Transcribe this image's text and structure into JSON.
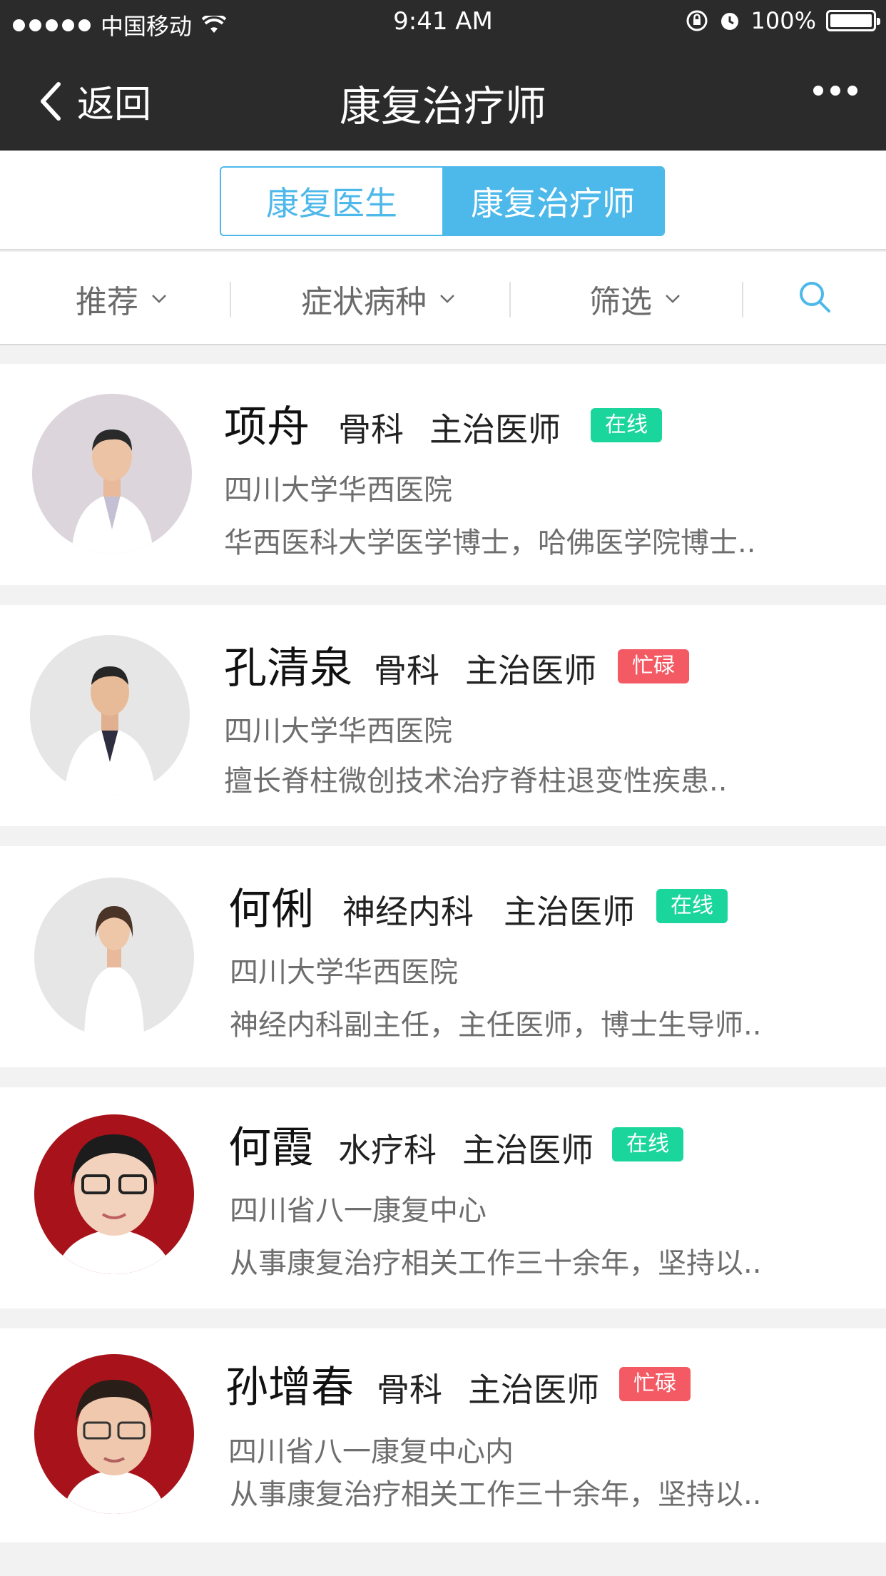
{
  "status_bar": {
    "carrier": "中国移动",
    "time": "9:41 AM",
    "battery": "100%",
    "battery_level": 1.0
  },
  "nav": {
    "back_label": "返回",
    "title": "康复治疗师"
  },
  "segments": [
    {
      "label": "康复医生",
      "active": false
    },
    {
      "label": "康复治疗师",
      "active": true
    }
  ],
  "filters": {
    "recommend": "推荐",
    "symptoms": "症状病种",
    "filter": "筛选"
  },
  "colors": {
    "accent": "#4db8ea",
    "online": "#1ad69c",
    "busy": "#f45a64",
    "nav_bg": "#2b2b2b"
  },
  "doctors": [
    {
      "name": "项舟",
      "dept": "骨科",
      "title": "主治医师",
      "status": "在线",
      "hospital": "四川大学华西医院",
      "desc": "华西医科大学医学博士，哈佛医学院博士.."
    },
    {
      "name": "孔清泉",
      "dept": "骨科",
      "title": "主治医师",
      "status": "忙碌",
      "hospital": "四川大学华西医院",
      "desc": "擅长脊柱微创技术治疗脊柱退变性疾患.."
    },
    {
      "name": "何俐",
      "dept": "神经内科",
      "title": "主治医师",
      "status": "在线",
      "hospital": "四川大学华西医院",
      "desc": "神经内科副主任，主任医师，博士生导师.."
    },
    {
      "name": "何霞",
      "dept": "水疗科",
      "title": "主治医师",
      "status": "在线",
      "hospital": "四川省八一康复中心",
      "desc": "从事康复治疗相关工作三十余年，坚持以.."
    },
    {
      "name": "孙增春",
      "dept": "骨科",
      "title": "主治医师",
      "status": "忙碌",
      "hospital": "四川省八一康复中心内",
      "desc": "从事康复治疗相关工作三十余年，坚持以.."
    }
  ]
}
